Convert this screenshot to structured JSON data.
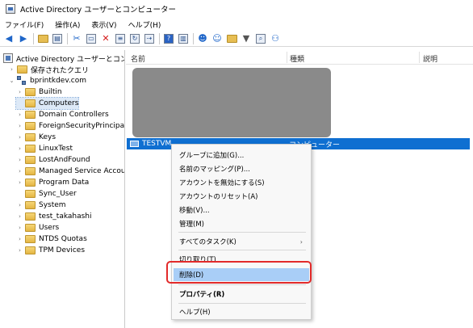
{
  "window": {
    "title": "Active Directory ユーザーとコンピューター"
  },
  "menubar": {
    "items": [
      "ファイル(F)",
      "操作(A)",
      "表示(V)",
      "ヘルプ(H)"
    ]
  },
  "toolbar": {
    "icons": [
      "back-arrow-icon",
      "forward-arrow-icon",
      "up-folder-icon",
      "console-tree-icon",
      "cut-icon",
      "copy-icon",
      "delete-icon",
      "properties-icon",
      "refresh-icon",
      "export-icon",
      "help-icon",
      "show-pane-icon",
      "user-icon",
      "group-icon",
      "ou-icon",
      "filter-icon",
      "find-icon",
      "add-to-group-icon"
    ]
  },
  "tree": {
    "root": "Active Directory ユーザーとコンピュー",
    "saved_queries": "保存されたクエリ",
    "domain": "bprintkdev.com",
    "items": [
      "Builtin",
      "Computers",
      "Domain Controllers",
      "ForeignSecurityPrincipals",
      "Keys",
      "LinuxTest",
      "LostAndFound",
      "Managed Service Accoun",
      "Program Data",
      "Sync_User",
      "System",
      "test_takahashi",
      "Users",
      "NTDS Quotas",
      "TPM Devices"
    ],
    "selected": "Computers"
  },
  "list": {
    "columns": [
      "名前",
      "種類",
      "説明"
    ],
    "selected_row": {
      "name": "TESTVM",
      "type": "コンピューター"
    }
  },
  "context_menu": {
    "items": [
      "グループに追加(G)...",
      "名前のマッピング(P)...",
      "アカウントを無効にする(S)",
      "アカウントのリセット(A)",
      "移動(V)...",
      "管理(M)",
      "すべてのタスク(K)",
      "切り取り(T)",
      "削除(D)",
      "プロパティ(R)",
      "ヘルプ(H)"
    ],
    "highlighted": "削除(D)",
    "submenu_chevron": "›"
  },
  "colors": {
    "selection_blue": "#0f6fd1",
    "menu_highlight": "#a9cef7",
    "annotation_red": "#e22a2a",
    "redaction_gray": "#8a8a8a"
  }
}
